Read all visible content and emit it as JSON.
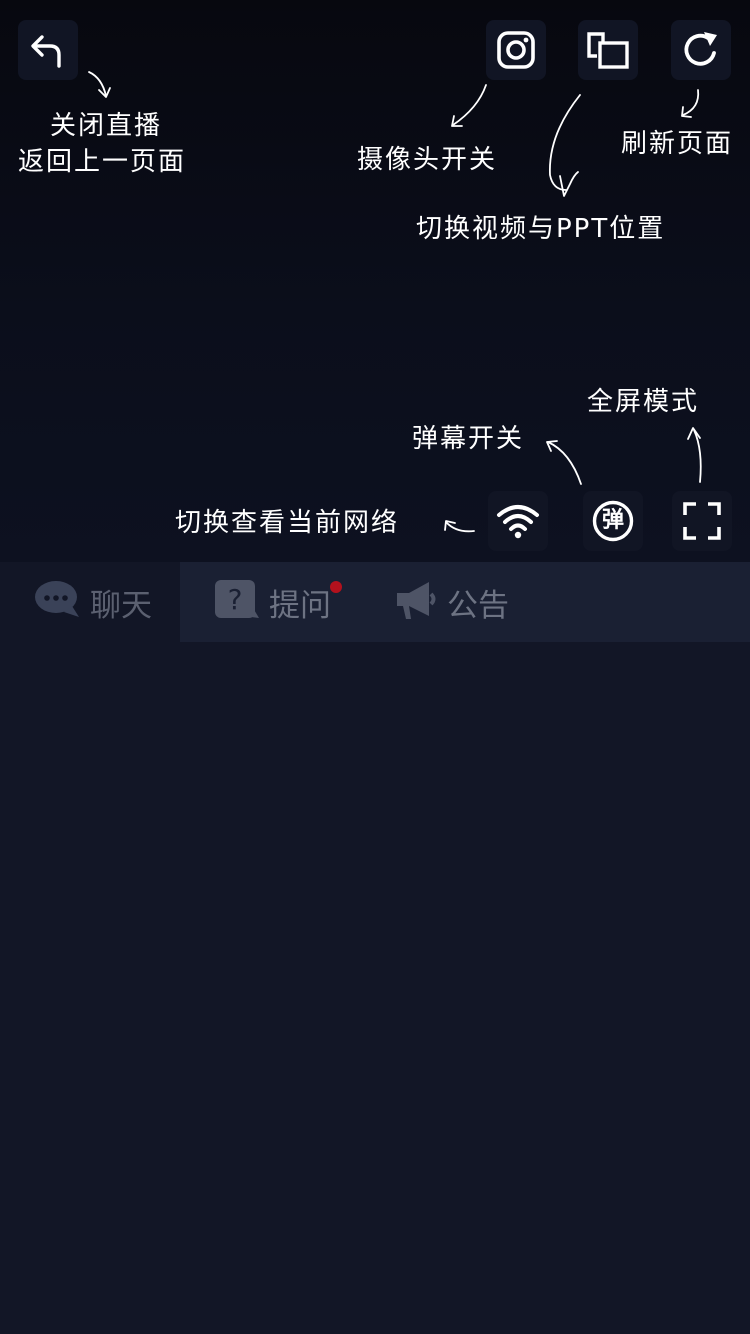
{
  "player": {
    "controls": {
      "back_icon": "back-arrow-icon",
      "camera_icon": "camera-icon",
      "switch_icon": "switch-screens-icon",
      "refresh_icon": "refresh-icon",
      "network_icon": "wifi-icon",
      "danmaku_icon": "danmaku-icon",
      "danmaku_glyph": "弹",
      "fullscreen_icon": "fullscreen-icon"
    },
    "hints": {
      "close_live_line1": "关闭直播",
      "close_live_line2": "返回上一页面",
      "camera_toggle": "摄像头开关",
      "refresh_page": "刷新页面",
      "switch_video_ppt": "切换视频与PPT位置",
      "fullscreen_mode": "全屏模式",
      "danmaku_toggle": "弹幕开关",
      "network_check": "切换查看当前网络"
    }
  },
  "tabs": [
    {
      "label": "聊天",
      "icon": "chat-bubble-icon",
      "active": true
    },
    {
      "label": "提问",
      "icon": "question-icon",
      "active": false,
      "has_badge": true
    },
    {
      "label": "公告",
      "icon": "megaphone-icon",
      "active": false
    }
  ],
  "colors": {
    "background": "#121626",
    "tab_bar": "#1a2033",
    "icon_tile": "#111524",
    "badge": "#b3111d",
    "tab_text": "#6d7383"
  }
}
